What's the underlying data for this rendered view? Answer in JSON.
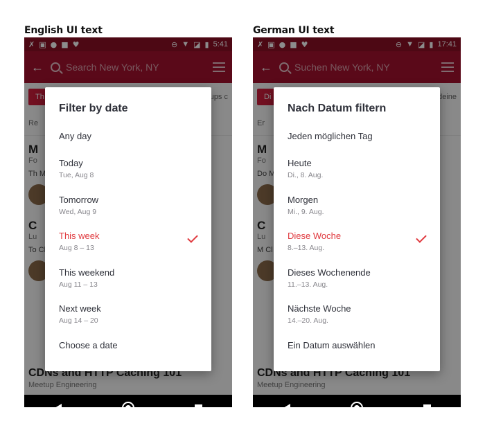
{
  "captions": {
    "english": "English UI text",
    "german": "German UI text"
  },
  "colors": {
    "status_bar": "#8c0f26",
    "toolbar": "#a5122f",
    "accent": "#e0393e",
    "chip": "#cf1e3c"
  },
  "english": {
    "status_time": "5:41",
    "search_placeholder": "Search New York, NY",
    "bg": {
      "chip": "Th",
      "chip2": "oups c",
      "filter": "Re",
      "card1_title": "M",
      "card1_sub": "Fo",
      "card1_text": "Th Me",
      "card2_title": "C",
      "card2_sub": "Lu",
      "card2_text": "To Ch",
      "bottom_title": "CDNs and HTTP Caching 101",
      "bottom_sub": "Meetup Engineering"
    },
    "dialog": {
      "title": "Filter by date",
      "options": [
        {
          "label": "Any day",
          "sub": ""
        },
        {
          "label": "Today",
          "sub": "Tue, Aug 8"
        },
        {
          "label": "Tomorrow",
          "sub": "Wed, Aug 9"
        },
        {
          "label": "This week",
          "sub": "Aug 8 – 13",
          "selected": true
        },
        {
          "label": "This weekend",
          "sub": "Aug 11 – 13"
        },
        {
          "label": "Next week",
          "sub": "Aug 14 – 20"
        },
        {
          "label": "Choose a date",
          "sub": ""
        }
      ]
    }
  },
  "german": {
    "status_time": "17:41",
    "search_placeholder": "Suchen New York, NY",
    "bg": {
      "chip": "Di",
      "chip2": "deine",
      "filter": "Er",
      "card1_title": "M",
      "card1_sub": "Fo",
      "card1_text": "Do Me",
      "card2_title": "C",
      "card2_sub": "Lu",
      "card2_text": "M Cl",
      "bottom_title": "CDNs and HTTP Caching 101",
      "bottom_sub": "Meetup Engineering"
    },
    "dialog": {
      "title": "Nach Datum filtern",
      "options": [
        {
          "label": "Jeden möglichen Tag",
          "sub": ""
        },
        {
          "label": "Heute",
          "sub": "Di., 8. Aug."
        },
        {
          "label": "Morgen",
          "sub": "Mi., 9. Aug."
        },
        {
          "label": "Diese Woche",
          "sub": "8.–13. Aug.",
          "selected": true
        },
        {
          "label": "Dieses Wochenende",
          "sub": "11.–13. Aug."
        },
        {
          "label": "Nächste Woche",
          "sub": "14.–20. Aug."
        },
        {
          "label": "Ein Datum auswählen",
          "sub": ""
        }
      ]
    }
  }
}
